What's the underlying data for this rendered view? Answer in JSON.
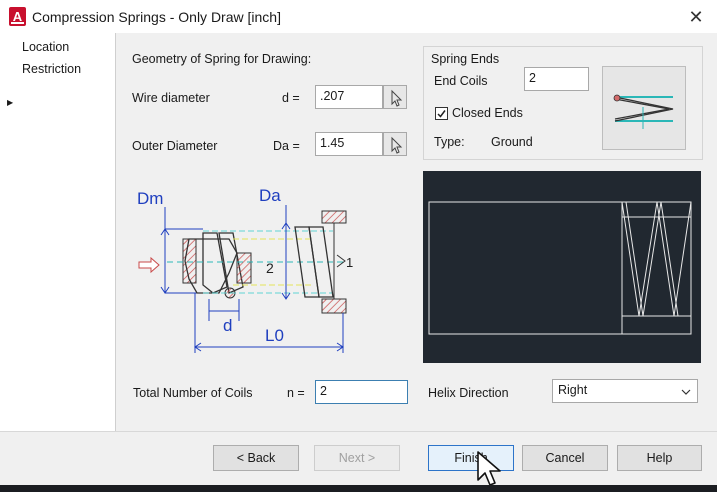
{
  "window": {
    "title": "Compression Springs - Only Draw [inch]",
    "close_glyph": "✕",
    "app_icon_letter": "A"
  },
  "nav": {
    "items": [
      {
        "label": "Location"
      },
      {
        "label": "Restriction"
      }
    ]
  },
  "geometry": {
    "heading": "Geometry of Spring for Drawing:",
    "wire": {
      "label": "Wire diameter",
      "symbol": "d =",
      "value": ".207"
    },
    "outer": {
      "label": "Outer Diameter",
      "symbol": "Da =",
      "value": "1.45"
    }
  },
  "spring_ends": {
    "heading": "Spring Ends",
    "end_coils_label": "End Coils",
    "end_coils_value": "2",
    "closed_ends_label": "Closed Ends",
    "closed_ends_checked": true,
    "type_label": "Type:",
    "type_value": "Ground"
  },
  "diagram": {
    "dm": "Dm",
    "da": "Da",
    "d": "d",
    "l0": "L0",
    "n1": "1",
    "n2": "2"
  },
  "coils": {
    "label": "Total Number of Coils",
    "symbol": "n =",
    "value": "2"
  },
  "helix": {
    "label": "Helix Direction",
    "value": "Right"
  },
  "buttons": {
    "back": "< Back",
    "next": "Next >",
    "finish": "Finish",
    "cancel": "Cancel",
    "help": "Help"
  },
  "colors": {
    "accent": "#2d74c9",
    "preview_bg": "#212830",
    "hatch": "#c84a4a",
    "dim_blue": "#1f3fbf"
  }
}
